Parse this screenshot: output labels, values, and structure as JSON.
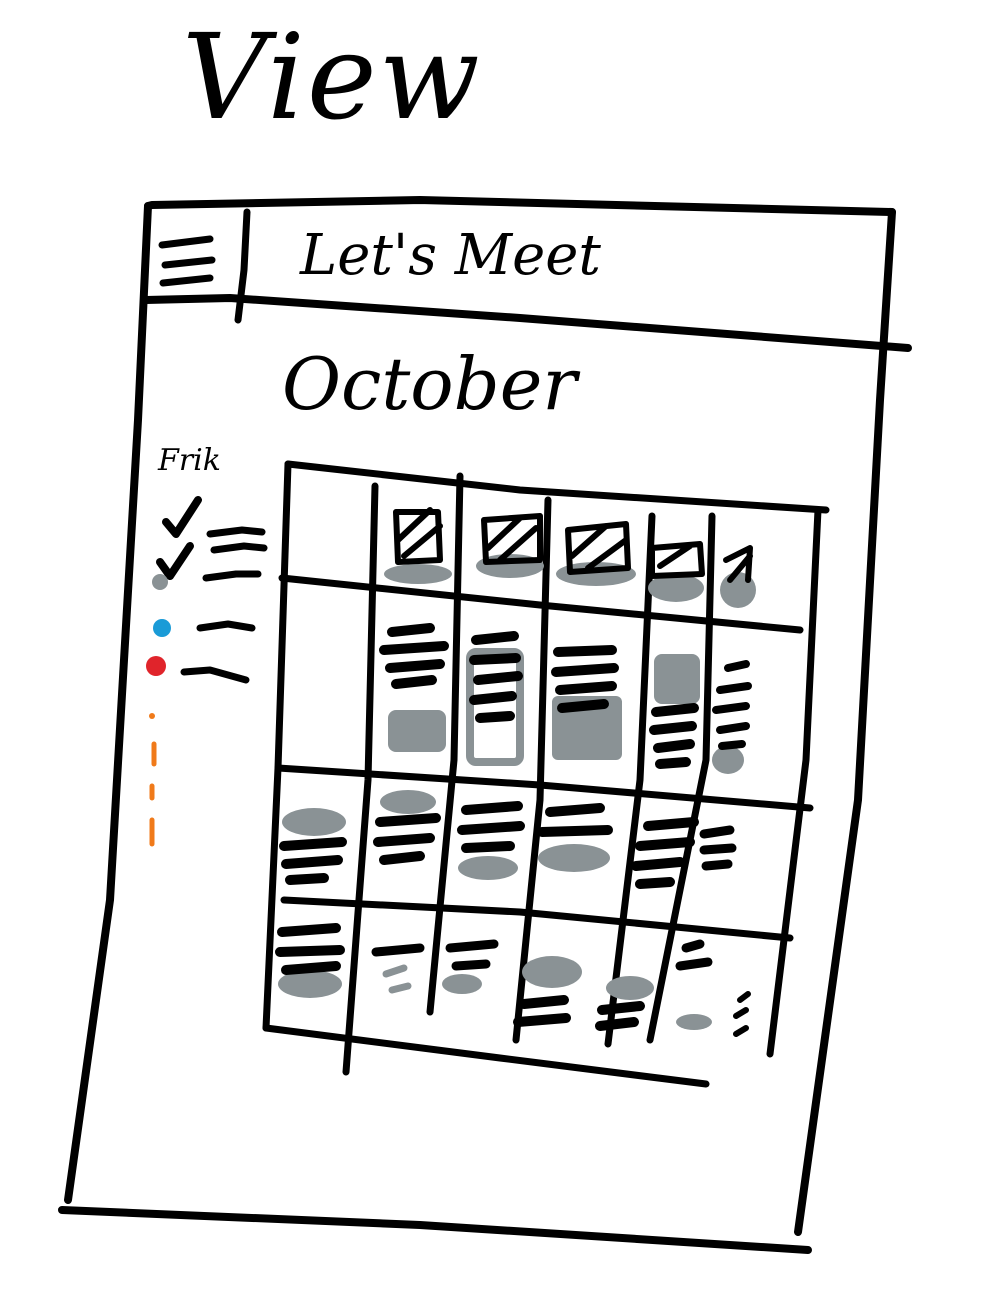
{
  "sketch_title": "View",
  "app": {
    "title": "Let's Meet",
    "menu_icon": "hamburger-menu-icon"
  },
  "calendar": {
    "month": "October",
    "columns": 6,
    "rows": 4
  },
  "legend": {
    "title": "Frik",
    "items": [
      {
        "marker": "check",
        "color": "#000000"
      },
      {
        "marker": "check",
        "color": "#000000"
      },
      {
        "marker": "dot",
        "color": "#8a9295"
      },
      {
        "marker": "dot",
        "color": "#1a9bd7"
      },
      {
        "marker": "dot",
        "color": "#e0242b"
      }
    ],
    "more_color": "#f07a1a"
  },
  "colors": {
    "ink": "#000000",
    "grey_ink": "#8a9295",
    "blue": "#1a9bd7",
    "red": "#e0242b",
    "orange": "#f07a1a"
  }
}
